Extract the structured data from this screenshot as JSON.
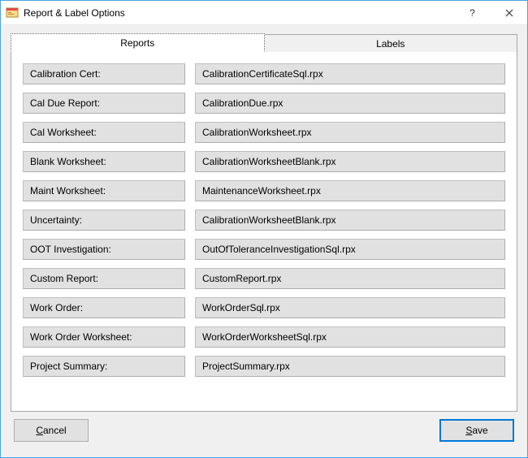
{
  "window": {
    "title": "Report & Label Options"
  },
  "tabs": {
    "reports": "Reports",
    "labels": "Labels"
  },
  "rows": [
    {
      "label": "Calibration Cert:",
      "value": "CalibrationCertificateSql.rpx"
    },
    {
      "label": "Cal Due Report:",
      "value": "CalibrationDue.rpx"
    },
    {
      "label": "Cal Worksheet:",
      "value": "CalibrationWorksheet.rpx"
    },
    {
      "label": "Blank Worksheet:",
      "value": "CalibrationWorksheetBlank.rpx"
    },
    {
      "label": "Maint Worksheet:",
      "value": "MaintenanceWorksheet.rpx"
    },
    {
      "label": "Uncertainty:",
      "value": "CalibrationWorksheetBlank.rpx"
    },
    {
      "label": "OOT Investigation:",
      "value": "OutOfToleranceInvestigationSql.rpx"
    },
    {
      "label": "Custom Report:",
      "value": "CustomReport.rpx"
    },
    {
      "label": "Work Order:",
      "value": "WorkOrderSql.rpx"
    },
    {
      "label": "Work Order Worksheet:",
      "value": "WorkOrderWorksheetSql.rpx"
    },
    {
      "label": "Project Summary:",
      "value": "ProjectSummary.rpx"
    }
  ],
  "buttons": {
    "cancel": "Cancel",
    "save": "Save"
  }
}
